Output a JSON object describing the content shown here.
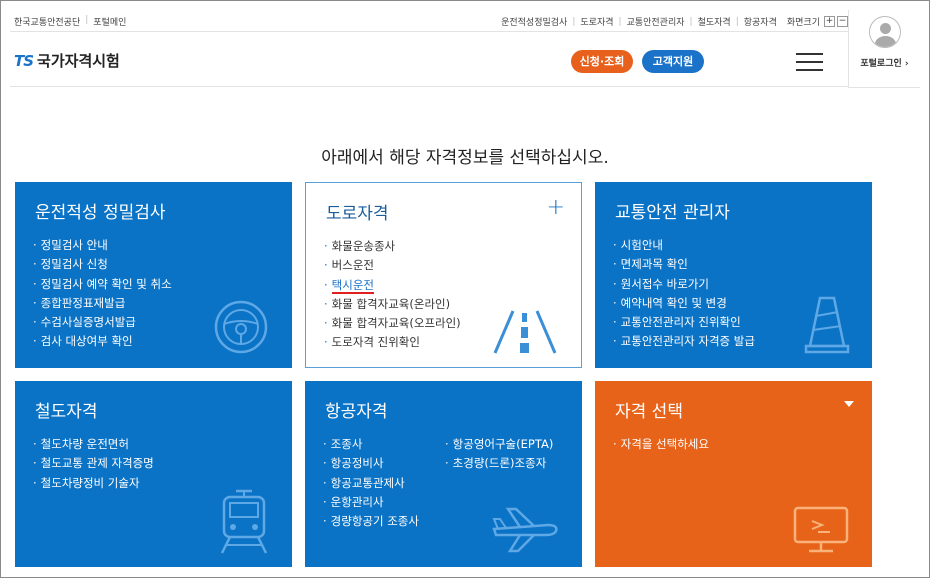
{
  "topbar": {
    "left_links": [
      "한국교통안전공단",
      "포털메인"
    ],
    "right_links": [
      "운전적성정밀검사",
      "도로자격",
      "교통안전관리자",
      "철도자격",
      "항공자격"
    ],
    "zoom_label": "화면크기",
    "zoom_in": "+",
    "zoom_out": "−"
  },
  "header": {
    "logo_ts": "TS",
    "logo_name": "국가자격시험",
    "apply_button": "신청·조회",
    "support_button": "고객지원",
    "login_label": "포털로그인 ›"
  },
  "heading": "아래에서 해당 자격정보를 선택하십시오.",
  "cards": {
    "aptitude": {
      "title": "운전적성 정밀검사",
      "items": [
        "정밀검사 안내",
        "정밀검사 신청",
        "정밀검사 예약 확인 및 취소",
        "종합판정표재발급",
        "수검사실증명서발급",
        "검사 대상여부 확인"
      ],
      "icon": "steering-wheel-icon"
    },
    "road": {
      "title": "도로자격",
      "plus": "+",
      "items": [
        "화물운송종사",
        "버스운전",
        "택시운전",
        "화물 합격자교육(온라인)",
        "화물 합격자교육(오프라인)",
        "도로자격 진위확인"
      ],
      "icon": "road-icon"
    },
    "safety": {
      "title": "교통안전 관리자",
      "items": [
        "시험안내",
        "면제과목 확인",
        "원서접수 바로가기",
        "예약내역 확인 및 변경",
        "교통안전관리자 진위확인",
        "교통안전관리자 자격증 발급"
      ],
      "icon": "traffic-cone-icon"
    },
    "rail": {
      "title": "철도자격",
      "items": [
        "철도차량 운전면허",
        "철도교통 관제 자격증명",
        "철도차량정비 기술자"
      ],
      "icon": "train-icon"
    },
    "aviation": {
      "title": "항공자격",
      "items_col1": [
        "조종사",
        "항공정비사",
        "항공교통관제사",
        "운항관리사",
        "경량항공기 조종사"
      ],
      "items_col2": [
        "항공영어구술(EPTA)",
        "초경량(드론)조종자"
      ],
      "icon": "airplane-icon"
    },
    "select": {
      "title": "자격 선택",
      "items": [
        "자격을 선택하세요"
      ],
      "icon": "monitor-icon"
    }
  },
  "colors": {
    "blue": "#0b73c6",
    "orange": "#e8631a",
    "highlight_underline": "#e02020"
  }
}
